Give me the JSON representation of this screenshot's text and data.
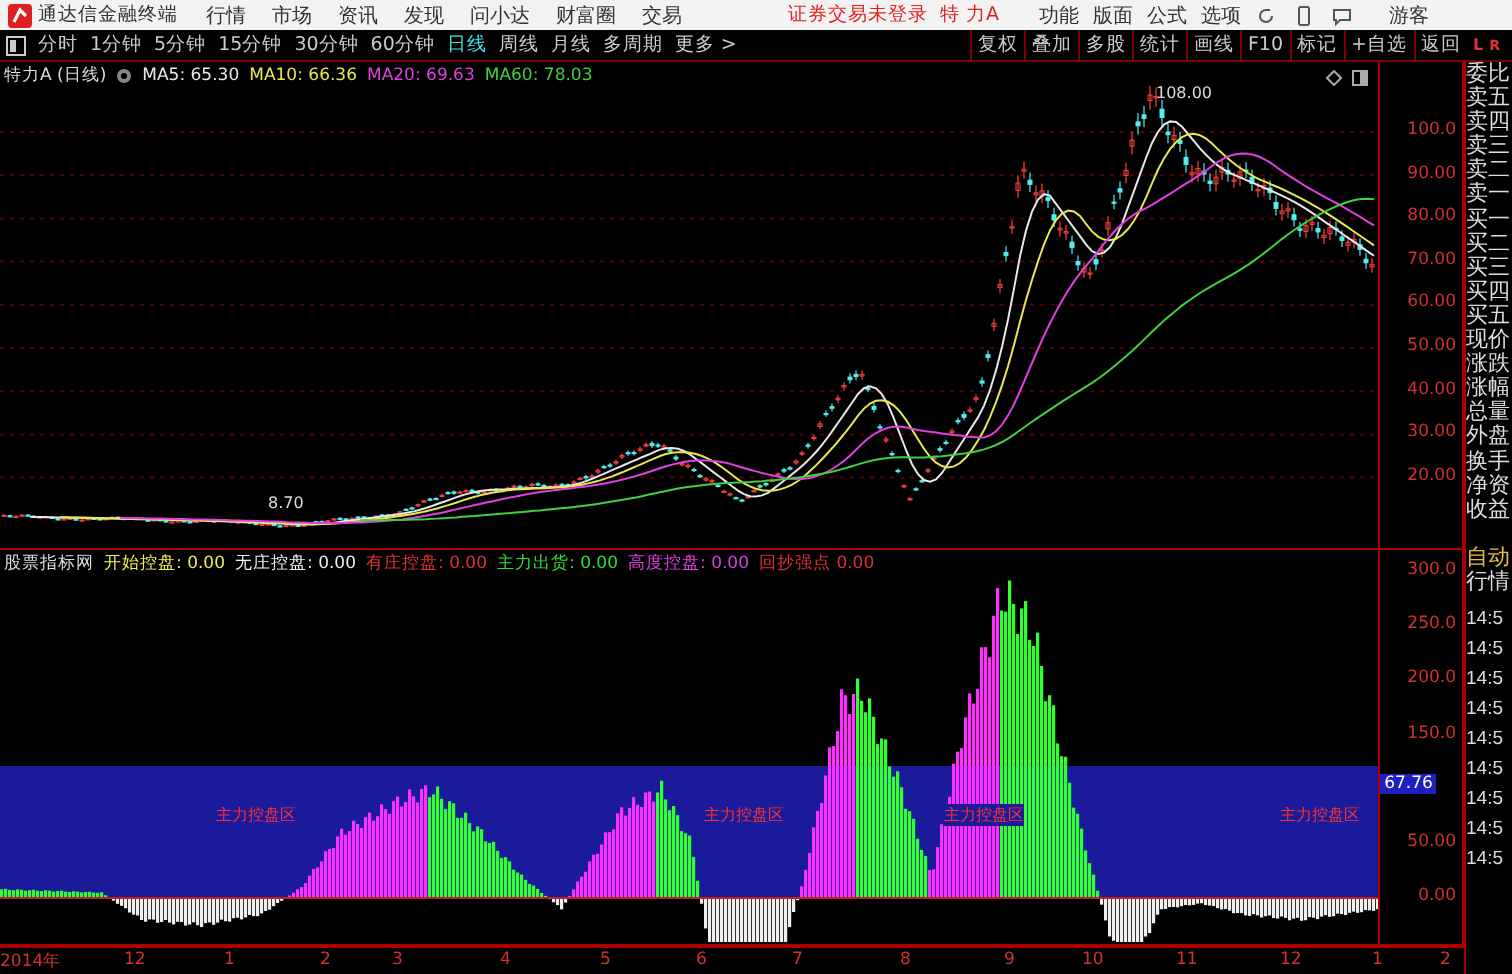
{
  "app_bar": {
    "title": "通达信金融终端",
    "menu": [
      "行情",
      "市场",
      "资讯",
      "发现",
      "问小达",
      "财富圈",
      "交易"
    ],
    "login_status": "证券交易未登录",
    "stock": "特 力A",
    "right_menu": [
      "功能",
      "版面",
      "公式",
      "选项"
    ],
    "user": "游客"
  },
  "toolbar": {
    "periods": [
      {
        "label": "分时",
        "selected": false
      },
      {
        "label": "1分钟",
        "selected": false
      },
      {
        "label": "5分钟",
        "selected": false
      },
      {
        "label": "15分钟",
        "selected": false
      },
      {
        "label": "30分钟",
        "selected": false
      },
      {
        "label": "60分钟",
        "selected": false
      },
      {
        "label": "日线",
        "selected": true
      },
      {
        "label": "周线",
        "selected": false
      },
      {
        "label": "月线",
        "selected": false
      },
      {
        "label": "多周期",
        "selected": false
      },
      {
        "label": "更多 >",
        "selected": false
      }
    ],
    "tools": [
      "复权",
      "叠加",
      "多股",
      "统计",
      "画线",
      "F10",
      "标记",
      "+自选",
      "返回"
    ]
  },
  "corner": {
    "left": "L",
    "right": "R"
  },
  "main_chart": {
    "title": "特力A (日线)",
    "mas": [
      {
        "label": "MA5: 65.30",
        "color": "#e8e8e8"
      },
      {
        "label": "MA10: 66.36",
        "color": "#e8e850"
      },
      {
        "label": "MA20: 69.63",
        "color": "#e040e0"
      },
      {
        "label": "MA60: 78.03",
        "color": "#40d040"
      }
    ],
    "y_ticks": [
      "100.0",
      "90.00",
      "80.00",
      "70.00",
      "60.00",
      "50.00",
      "40.00",
      "30.00",
      "20.00"
    ],
    "high_label": "108.00",
    "low_label": "8.70"
  },
  "indicator": {
    "name": "股票指标网",
    "fields": [
      {
        "label": "开始控盘: 0.00",
        "color": "#f0f050"
      },
      {
        "label": "无庄控盘: 0.00",
        "color": "#f0f0f0"
      },
      {
        "label": "有庄控盘: 0.00",
        "color": "#e03030"
      },
      {
        "label": "主力出货: 0.00",
        "color": "#30e030"
      },
      {
        "label": "高度控盘: 0.00",
        "color": "#e040e0"
      },
      {
        "label": "回抄强点 0.00",
        "color": "#e03030"
      }
    ],
    "y_ticks": [
      "300.0",
      "250.0",
      "200.0",
      "150.0",
      "50.00",
      "0.00"
    ],
    "current_value": "67.76",
    "zone_labels": [
      "主力控盘区",
      "主力控盘区",
      "主力控盘区",
      "主力控盘区"
    ]
  },
  "x_axis": [
    "2014年",
    "12",
    "1",
    "2",
    "3",
    "4",
    "5",
    "6",
    "7",
    "8",
    "9",
    "10",
    "11",
    "12",
    "1",
    "2"
  ],
  "side_panel": {
    "quote_labels": [
      "委比",
      "卖五",
      "卖四",
      "卖三",
      "卖二",
      "卖一",
      "买一",
      "买二",
      "买三",
      "买四",
      "买五",
      "现价",
      "涨跌",
      "涨幅",
      "总量",
      "外盘",
      "换手",
      "净资",
      "收益"
    ],
    "auto": "自动",
    "quote": "行情",
    "times": [
      "14:5",
      "14:5",
      "14:5",
      "14:5",
      "14:5",
      "14:5",
      "14:5",
      "14:5",
      "14:5"
    ]
  }
}
